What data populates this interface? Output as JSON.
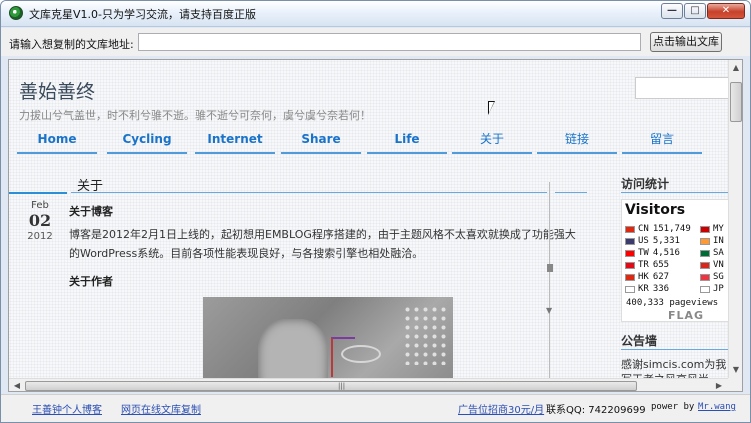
{
  "window": {
    "title": "文库克星V1.0-只为学习交流，请支持百度正版",
    "min_label": "—",
    "max_label": "□",
    "close_label": "✕"
  },
  "address": {
    "label": "请输入想复制的文库地址:",
    "value": "",
    "button_label": "点击输出文库"
  },
  "site": {
    "title": "善始善终",
    "subtitle": "力拔山兮气盖世，时不利兮骓不逝。骓不逝兮可奈何，虞兮虞兮奈若何！",
    "nav": [
      "Home",
      "Cycling",
      "Internet",
      "Share",
      "Life",
      "关于",
      "链接",
      "留言"
    ]
  },
  "post": {
    "section_title": "关于",
    "date": {
      "month": "Feb",
      "day": "02",
      "year": "2012"
    },
    "heading1": "关于博客",
    "paragraph": "博客是2012年2月1日上线的，起初想用EMBLOG程序搭建的，由于主题风格不太喜欢就换成了功能强大的WordPress系统。目前各项性能表现良好，与各搜索引擎也相处融洽。",
    "heading2": "关于作者"
  },
  "sidebar": {
    "stats_title": "访问统计",
    "widget_title": "Visitors",
    "stats_left": [
      {
        "code": "CN",
        "count": "151,749",
        "color": "#de2910"
      },
      {
        "code": "US",
        "count": "5,331",
        "color": "#3c3b6e"
      },
      {
        "code": "TW",
        "count": "4,516",
        "color": "#fe0000"
      },
      {
        "code": "TR",
        "count": "655",
        "color": "#e30a17"
      },
      {
        "code": "HK",
        "count": "627",
        "color": "#de2910"
      },
      {
        "code": "KR",
        "count": "336",
        "color": "#ffffff"
      }
    ],
    "stats_right": [
      {
        "code": "MY",
        "color": "#cc0001"
      },
      {
        "code": "IN",
        "color": "#ff9933"
      },
      {
        "code": "SA",
        "color": "#006c35"
      },
      {
        "code": "VN",
        "color": "#da251d"
      },
      {
        "code": "SG",
        "color": "#ef3340"
      },
      {
        "code": "JP",
        "color": "#ffffff"
      }
    ],
    "pageviews": "400,333 pageviews",
    "flagcounter": "FLAG",
    "notice_title": "公告墙",
    "notice_text": "感谢simcis.com为我写王者之风高风尚"
  },
  "status": {
    "link1": "王善钟个人博客",
    "link2": "网页在线文库复制",
    "ad_link": "广告位招商30元/月",
    "qq": "联系QQ: 742209699",
    "powered": "power by",
    "author": "Mr.wang"
  }
}
